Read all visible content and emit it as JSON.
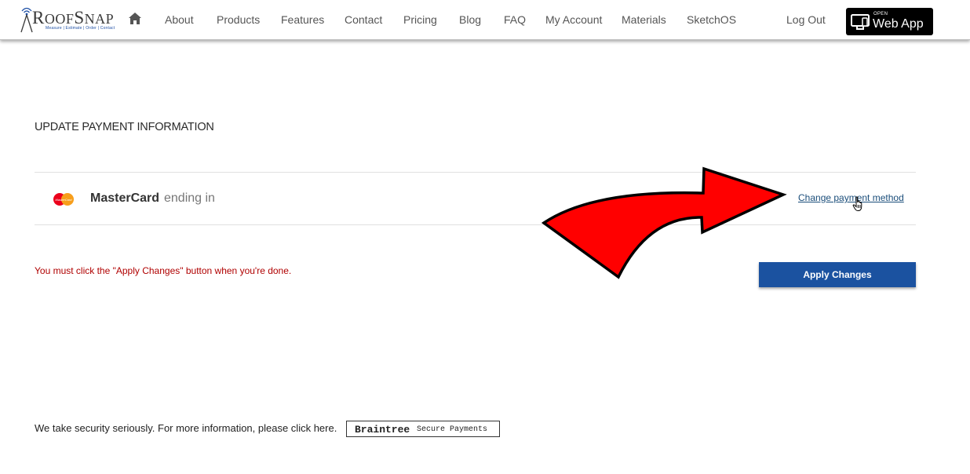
{
  "header": {
    "logo": {
      "text_big": "R",
      "text_rest": "OOF",
      "text_big2": "S",
      "text_rest2": "NAP",
      "tagline": "Measure | Estimate | Order | Contact",
      "icon": "signal-tower-icon"
    },
    "home_icon": "home-icon",
    "nav": [
      {
        "label": "About"
      },
      {
        "label": "Products"
      },
      {
        "label": "Features"
      },
      {
        "label": "Contact"
      },
      {
        "label": "Pricing"
      },
      {
        "label": "Blog"
      },
      {
        "label": "FAQ"
      },
      {
        "label": "My Account"
      },
      {
        "label": "Materials"
      },
      {
        "label": "SketchOS"
      }
    ],
    "logout_label": "Log Out",
    "webapp": {
      "open_label": "OPEN",
      "label": "Web App",
      "icon": "monitor-icon"
    }
  },
  "main": {
    "title": "UPDATE PAYMENT INFORMATION",
    "payment": {
      "card_icon": "mastercard-icon",
      "card_icon_text": "MasterCard",
      "brand": "MasterCard",
      "suffix": "ending in",
      "change_link": "Change payment method"
    },
    "notice": "You must click the \"Apply Changes\" button when you're done.",
    "apply_button": "Apply Changes",
    "security_text": "We take security seriously. For more information, please click here.",
    "braintree": {
      "name": "Braintree",
      "sub": "Secure Payments"
    }
  },
  "colors": {
    "primary_button": "#1b52a0",
    "notice": "#b00000",
    "link": "#1a4d7a",
    "arrow": "#ff0000",
    "webapp_bg": "#000000"
  }
}
